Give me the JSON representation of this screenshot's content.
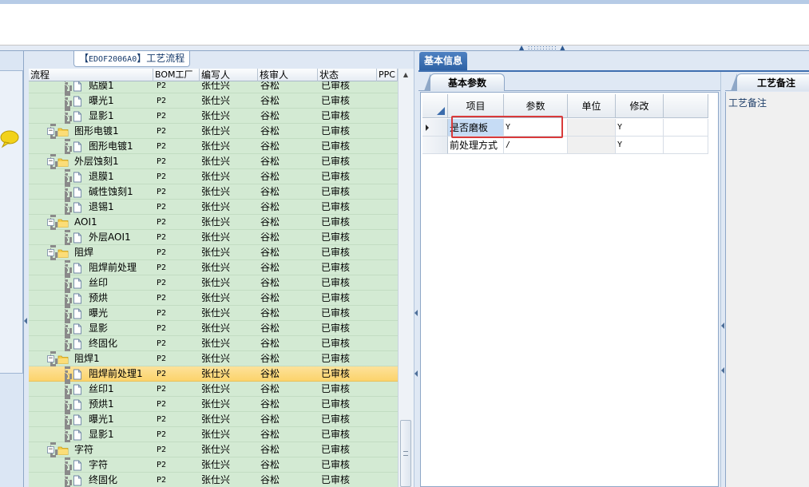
{
  "tree_panel": {
    "title_prefix": "【",
    "title_code": "EDOF2006A0",
    "title_suffix": "】工艺流程",
    "columns": [
      "流程",
      "BOM工厂",
      "编写人",
      "核审人",
      "状态",
      "PPC"
    ],
    "rows": [
      {
        "name": "贴膜1",
        "type": "leaf",
        "level": 2,
        "factory": "P2",
        "writer": "张仕兴",
        "reviewer": "谷松",
        "status": "已审核"
      },
      {
        "name": "曝光1",
        "type": "leaf",
        "level": 2,
        "factory": "P2",
        "writer": "张仕兴",
        "reviewer": "谷松",
        "status": "已审核"
      },
      {
        "name": "显影1",
        "type": "leaf",
        "level": 2,
        "factory": "P2",
        "writer": "张仕兴",
        "reviewer": "谷松",
        "status": "已审核"
      },
      {
        "name": "图形电镀1",
        "type": "folder",
        "level": 1,
        "factory": "P2",
        "writer": "张仕兴",
        "reviewer": "谷松",
        "status": "已审核"
      },
      {
        "name": "图形电镀1",
        "type": "leaf",
        "level": 2,
        "factory": "P2",
        "writer": "张仕兴",
        "reviewer": "谷松",
        "status": "已审核"
      },
      {
        "name": "外层蚀刻1",
        "type": "folder",
        "level": 1,
        "factory": "P2",
        "writer": "张仕兴",
        "reviewer": "谷松",
        "status": "已审核"
      },
      {
        "name": "退膜1",
        "type": "leaf",
        "level": 2,
        "factory": "P2",
        "writer": "张仕兴",
        "reviewer": "谷松",
        "status": "已审核"
      },
      {
        "name": "碱性蚀刻1",
        "type": "leaf",
        "level": 2,
        "factory": "P2",
        "writer": "张仕兴",
        "reviewer": "谷松",
        "status": "已审核"
      },
      {
        "name": "退锡1",
        "type": "leaf",
        "level": 2,
        "factory": "P2",
        "writer": "张仕兴",
        "reviewer": "谷松",
        "status": "已审核"
      },
      {
        "name": "AOI1",
        "type": "folder",
        "level": 1,
        "factory": "P2",
        "writer": "张仕兴",
        "reviewer": "谷松",
        "status": "已审核"
      },
      {
        "name": "外层AOI1",
        "type": "leaf",
        "level": 2,
        "factory": "P2",
        "writer": "张仕兴",
        "reviewer": "谷松",
        "status": "已审核"
      },
      {
        "name": "阻焊",
        "type": "folder",
        "level": 1,
        "factory": "P2",
        "writer": "张仕兴",
        "reviewer": "谷松",
        "status": "已审核"
      },
      {
        "name": "阻焊前处理",
        "type": "leaf",
        "level": 2,
        "factory": "P2",
        "writer": "张仕兴",
        "reviewer": "谷松",
        "status": "已审核"
      },
      {
        "name": "丝印",
        "type": "leaf",
        "level": 2,
        "factory": "P2",
        "writer": "张仕兴",
        "reviewer": "谷松",
        "status": "已审核"
      },
      {
        "name": "预烘",
        "type": "leaf",
        "level": 2,
        "factory": "P2",
        "writer": "张仕兴",
        "reviewer": "谷松",
        "status": "已审核"
      },
      {
        "name": "曝光",
        "type": "leaf",
        "level": 2,
        "factory": "P2",
        "writer": "张仕兴",
        "reviewer": "谷松",
        "status": "已审核"
      },
      {
        "name": "显影",
        "type": "leaf",
        "level": 2,
        "factory": "P2",
        "writer": "张仕兴",
        "reviewer": "谷松",
        "status": "已审核"
      },
      {
        "name": "终固化",
        "type": "leaf",
        "level": 2,
        "factory": "P2",
        "writer": "张仕兴",
        "reviewer": "谷松",
        "status": "已审核"
      },
      {
        "name": "阻焊1",
        "type": "folder",
        "level": 1,
        "factory": "P2",
        "writer": "张仕兴",
        "reviewer": "谷松",
        "status": "已审核"
      },
      {
        "name": "阻焊前处理1",
        "type": "leaf",
        "level": 2,
        "factory": "P2",
        "writer": "张仕兴",
        "reviewer": "谷松",
        "status": "已审核",
        "selected": true
      },
      {
        "name": "丝印1",
        "type": "leaf",
        "level": 2,
        "factory": "P2",
        "writer": "张仕兴",
        "reviewer": "谷松",
        "status": "已审核"
      },
      {
        "name": "预烘1",
        "type": "leaf",
        "level": 2,
        "factory": "P2",
        "writer": "张仕兴",
        "reviewer": "谷松",
        "status": "已审核"
      },
      {
        "name": "曝光1",
        "type": "leaf",
        "level": 2,
        "factory": "P2",
        "writer": "张仕兴",
        "reviewer": "谷松",
        "status": "已审核"
      },
      {
        "name": "显影1",
        "type": "leaf",
        "level": 2,
        "factory": "P2",
        "writer": "张仕兴",
        "reviewer": "谷松",
        "status": "已审核"
      },
      {
        "name": "字符",
        "type": "folder",
        "level": 1,
        "factory": "P2",
        "writer": "张仕兴",
        "reviewer": "谷松",
        "status": "已审核"
      },
      {
        "name": "字符",
        "type": "leaf",
        "level": 2,
        "factory": "P2",
        "writer": "张仕兴",
        "reviewer": "谷松",
        "status": "已审核"
      },
      {
        "name": "终固化",
        "type": "leaf",
        "level": 2,
        "factory": "P2",
        "writer": "张仕兴",
        "reviewer": "谷松",
        "status": "已审核"
      }
    ]
  },
  "info_panel": {
    "tab_label": "基本信息",
    "subtab_label": "基本参数",
    "grid": {
      "columns": [
        "项目",
        "参数",
        "单位",
        "修改"
      ],
      "rows": [
        {
          "item": "是否磨板",
          "param": "Y",
          "unit": "",
          "modify": "Y",
          "current": true
        },
        {
          "item": "前处理方式",
          "param": "/",
          "unit": "",
          "modify": "Y",
          "current": false
        }
      ]
    }
  },
  "note_panel": {
    "tab_label": "工艺备注",
    "field_label": "工艺备注"
  },
  "colors": {
    "row_green": "#d3ead3",
    "row_selected": "#fcd36b",
    "tab_blue": "#2e62a5",
    "highlight_box": "#d93a3a"
  },
  "icons": {
    "folder": "folder-icon",
    "document": "document-icon",
    "chat": "chat-bubble-icon"
  }
}
